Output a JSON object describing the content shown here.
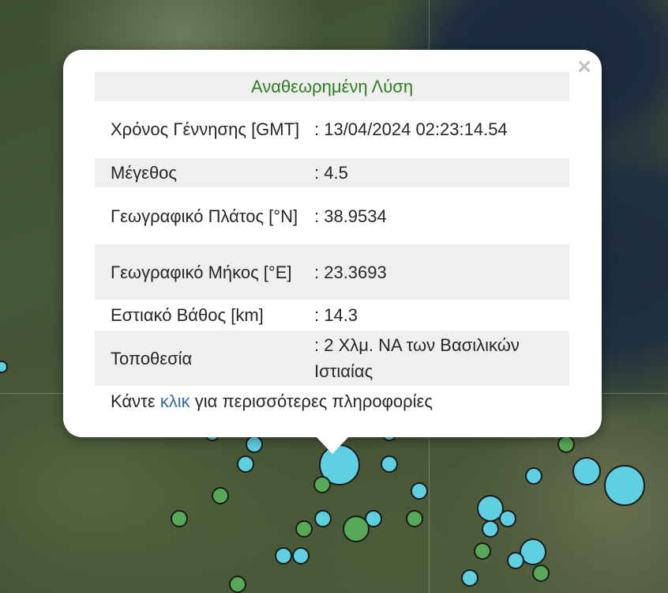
{
  "popup": {
    "header": "Αναθεωρημένη Λύση",
    "close_symbol": "×",
    "rows": [
      {
        "label": "Χρόνος Γέννησης [GMT]",
        "value": ": 13/04/2024 02:23:14.54"
      },
      {
        "label": "Μέγεθος",
        "value": ": 4.5"
      },
      {
        "label": "Γεωγραφικό Πλάτος [°N]",
        "value": ": 38.9534"
      },
      {
        "label": "Γεωγραφικό Μήκος [°E]",
        "value": ": 23.3693"
      },
      {
        "label": "Εστιακό Βάθος [km]",
        "value": ": 14.3"
      },
      {
        "label": "Τοποθεσία",
        "value": ": 2 Χλμ. ΝΑ των Βασιλικών Ιστιαίας"
      }
    ],
    "footer": {
      "prefix": "Κάντε ",
      "link": "κλικ",
      "suffix": " για περισσότερες πληροφορίες"
    }
  },
  "colors": {
    "header_text": "#2e7d1f",
    "link": "#2f6da3",
    "marker_recent": "#5fd0e2",
    "marker_older": "#58a957"
  },
  "icons": {
    "close": "close-icon"
  }
}
